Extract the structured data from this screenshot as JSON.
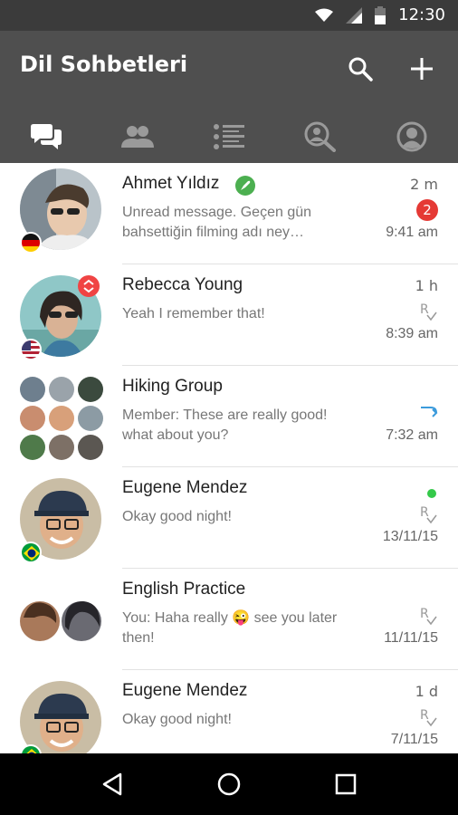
{
  "status_bar": {
    "time": "12:30"
  },
  "app_bar": {
    "title": "Dil Sohbetleri"
  },
  "tabs": [
    {
      "icon": "chats-icon"
    },
    {
      "icon": "contacts-icon"
    },
    {
      "icon": "list-icon"
    },
    {
      "icon": "search-partner-icon"
    },
    {
      "icon": "profile-icon"
    }
  ],
  "colors": {
    "app_bar": "#4f4f4f",
    "status_bar": "#3b3b3b",
    "badge": "#e53935",
    "online": "#34c94a",
    "verified": "#4caf50"
  },
  "conversations": [
    {
      "name": "Ahmet Yıldız",
      "preview": "Unread message. Geçen gün bahsettiğin filming adı ney…",
      "relative": "2 m",
      "time": "9:41 am",
      "unread": "2",
      "flag": "germany",
      "verified": true
    },
    {
      "name": "Rebecca Young",
      "preview": "Yeah I remember that!",
      "relative": "1 h",
      "time": "8:39 am",
      "flag": "usa"
    },
    {
      "name": "Hiking Group",
      "preview": "Member: These are really good! what about you?",
      "relative": "",
      "time": "7:32 am"
    },
    {
      "name": "Eugene Mendez",
      "preview": "Okay good night!",
      "relative": "",
      "time": "13/11/15",
      "flag": "brazil",
      "online": true
    },
    {
      "name": "English Practice",
      "preview": "You: Haha really 😜 see you later then!",
      "relative": "",
      "time": "11/11/15"
    },
    {
      "name": "Eugene Mendez",
      "preview": "Okay good night!",
      "relative": "1 d",
      "time": "7/11/15",
      "flag": "brazil"
    }
  ]
}
